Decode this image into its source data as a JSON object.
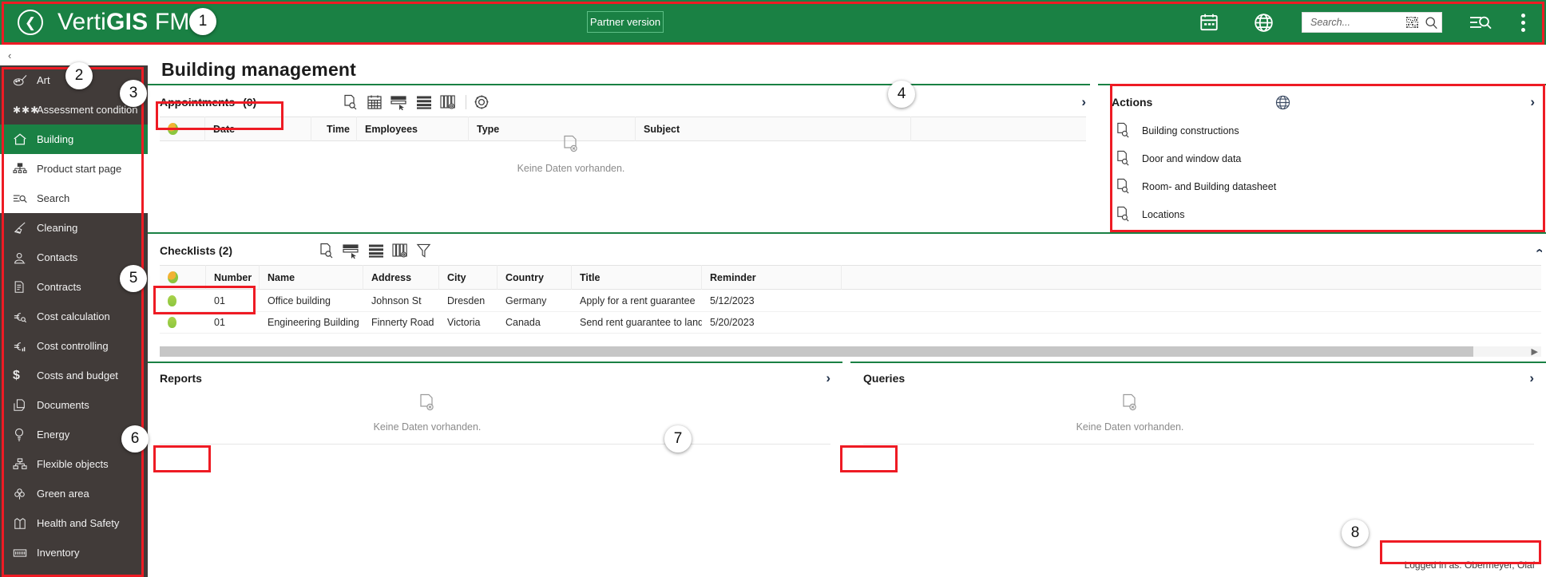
{
  "header": {
    "back_icon": "chevron-left-circle-icon",
    "brand_prefix": "Verti",
    "brand_bold": "GIS",
    "brand_suffix": "FM",
    "brand_tm": "™",
    "partner_button": "Partner version",
    "calendar_icon": "calendar-icon",
    "globe_icon": "globe-icon",
    "advanced_search_icon": "advanced-search-icon",
    "more_icon": "kebab-menu-icon",
    "accent_color": "#1a8144"
  },
  "search": {
    "placeholder": "Search...",
    "value": "",
    "barcode_icon": "barcode-scan-icon",
    "search_icon": "magnifier-icon"
  },
  "sidebar": {
    "collapse_label": "‹",
    "items": [
      {
        "label": "Art",
        "icon": "palette-icon",
        "state": "dark"
      },
      {
        "label": "Assessment condition",
        "icon": "dots-icon",
        "state": "dark"
      },
      {
        "label": "Building",
        "icon": "home-icon",
        "state": "active"
      },
      {
        "label": "Product start page",
        "icon": "sitemap-icon",
        "state": "light"
      },
      {
        "label": "Search",
        "icon": "advanced-search-icon",
        "state": "light"
      },
      {
        "label": "Cleaning",
        "icon": "broom-icon",
        "state": "dark"
      },
      {
        "label": "Contacts",
        "icon": "contact-icon",
        "state": "dark"
      },
      {
        "label": "Contracts",
        "icon": "contract-icon",
        "state": "dark"
      },
      {
        "label": "Cost calculation",
        "icon": "euro-search-icon",
        "state": "dark"
      },
      {
        "label": "Cost controlling",
        "icon": "euro-chart-icon",
        "state": "dark"
      },
      {
        "label": "Costs and budget",
        "icon": "dollar-icon",
        "state": "dark"
      },
      {
        "label": "Documents",
        "icon": "documents-icon",
        "state": "dark"
      },
      {
        "label": "Energy",
        "icon": "lightbulb-icon",
        "state": "dark"
      },
      {
        "label": "Flexible objects",
        "icon": "hierarchy-icon",
        "state": "dark"
      },
      {
        "label": "Green area",
        "icon": "tree-icon",
        "state": "dark"
      },
      {
        "label": "Health and Safety",
        "icon": "safety-vest-icon",
        "state": "dark"
      },
      {
        "label": "Inventory",
        "icon": "inventory-icon",
        "state": "dark"
      }
    ]
  },
  "main": {
    "page_title": "Building management"
  },
  "appointments": {
    "title": "Appointments",
    "count": "(0)",
    "toolbar": [
      "report-preview-icon",
      "calendar-icon",
      "select-row-icon",
      "list-view-icon",
      "columns-settings-icon",
      "gear-icon"
    ],
    "columns": [
      {
        "label": "",
        "icon": "status-bulb-icon"
      },
      {
        "label": "Date"
      },
      {
        "label": "Time",
        "align": "right"
      },
      {
        "label": "Employees"
      },
      {
        "label": "Type"
      },
      {
        "label": "Subject"
      }
    ],
    "empty_text": "Keine Daten vorhanden.",
    "empty_icon": "no-data-document-icon",
    "expand_icon": "chevron-right-icon"
  },
  "actions": {
    "title": "Actions",
    "globe_icon": "globe-icon",
    "expand_icon": "chevron-right-icon",
    "items": [
      {
        "label": "Building constructions",
        "icon": "report-preview-icon"
      },
      {
        "label": "Door and window data",
        "icon": "report-preview-icon"
      },
      {
        "label": "Room- and Building datasheet",
        "icon": "report-preview-icon"
      },
      {
        "label": "Locations",
        "icon": "report-preview-icon"
      }
    ]
  },
  "checklists": {
    "title": "Checklists (2)",
    "toolbar": [
      "report-preview-icon",
      "select-row-icon",
      "list-view-icon",
      "columns-settings-icon",
      "filter-icon"
    ],
    "collapse_icon": "chevron-up-icon",
    "columns": [
      "",
      "Number",
      "Name",
      "Address",
      "City",
      "Country",
      "Title",
      "Reminder"
    ],
    "status_icon": "status-bulb-icon",
    "rows": [
      {
        "status": "green",
        "number": "01",
        "name": "Office building",
        "address": "Johnson St",
        "city": "Dresden",
        "country": "Germany",
        "title": "Apply for a rent guarantee",
        "reminder": "5/12/2023"
      },
      {
        "status": "green",
        "number": "01",
        "name": "Engineering Building",
        "address": "Finnerty Road",
        "city": "Victoria",
        "country": "Canada",
        "title": "Send rent guarantee to landl...",
        "reminder": "5/20/2023"
      }
    ]
  },
  "reports": {
    "title": "Reports",
    "empty_text": "Keine Daten vorhanden.",
    "empty_icon": "no-data-document-icon",
    "expand_icon": "chevron-right-icon"
  },
  "queries": {
    "title": "Queries",
    "empty_text": "Keine Daten vorhanden.",
    "empty_icon": "no-data-document-icon",
    "expand_icon": "chevron-right-icon"
  },
  "status_bar": {
    "logged_in": "Logged in as: Obermeyer, Olaf"
  },
  "annotations": {
    "color": "#ee1b24",
    "callouts": [
      "1",
      "2",
      "3",
      "4",
      "5",
      "6",
      "7",
      "8"
    ]
  }
}
